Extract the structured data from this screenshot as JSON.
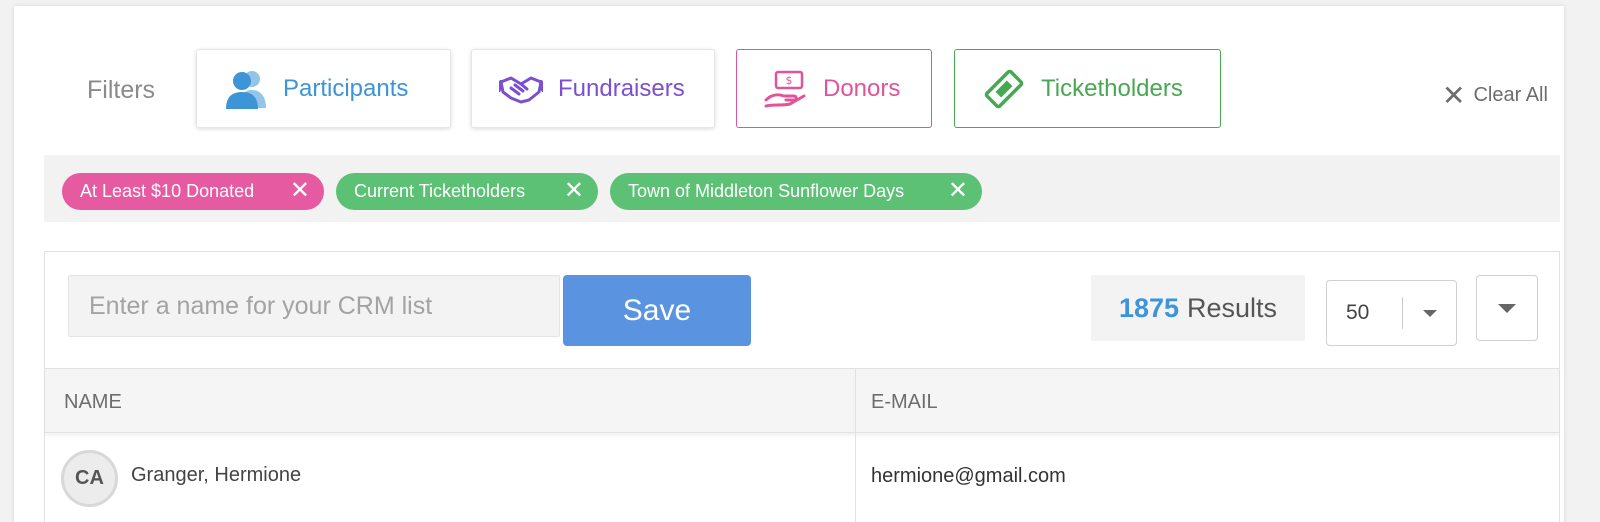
{
  "filters": {
    "label": "Filters",
    "buttons": {
      "participants": "Participants",
      "fundraisers": "Fundraisers",
      "donors": "Donors",
      "ticketholders": "Ticketholders"
    },
    "clear_all": "Clear All"
  },
  "active_tags": [
    {
      "label": "At Least $10 Donated",
      "color": "#e55aa1"
    },
    {
      "label": "Current Ticketholders",
      "color": "#5cc174"
    },
    {
      "label": "Town of Middleton Sunflower Days",
      "color": "#5cc174"
    }
  ],
  "list": {
    "name_input_placeholder": "Enter a name for your CRM list",
    "name_input_value": "",
    "save_label": "Save",
    "results_count": "1875",
    "results_label": "Results",
    "per_page": "50"
  },
  "table": {
    "columns": [
      "NAME",
      "E-MAIL"
    ],
    "rows": [
      {
        "initials": "CA",
        "name": "Granger, Hermione",
        "email": "hermione@gmail.com"
      }
    ]
  },
  "colors": {
    "participants": "#3d94d6",
    "fundraisers": "#7b4fcf",
    "donors": "#e05599",
    "ticketholders": "#47a852",
    "save": "#5a94e0"
  },
  "icons": {
    "participants": "people-icon",
    "fundraisers": "handshake-icon",
    "donors": "money-hand-icon",
    "ticketholders": "ticket-icon",
    "clear_all": "close-icon",
    "tag_remove": "close-icon",
    "per_page": "chevron-down-icon",
    "expand": "chevron-down-icon"
  }
}
